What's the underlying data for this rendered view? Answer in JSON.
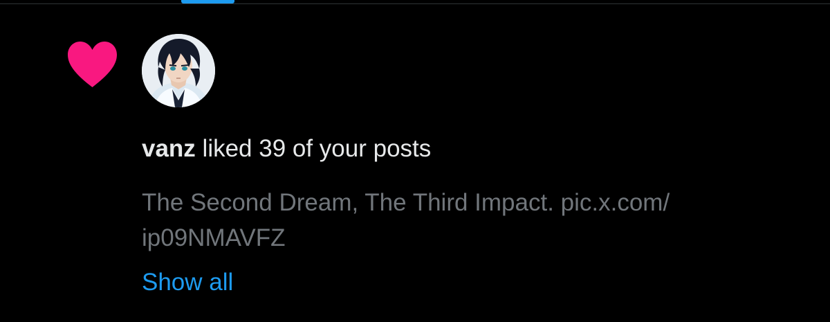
{
  "colors": {
    "background": "#000000",
    "accent": "#1d9bf0",
    "like": "#f91880",
    "primary_text": "#e7e9ea",
    "secondary_text": "#71767b"
  },
  "tab_indicator": {
    "active": true
  },
  "notification": {
    "type_icon": "heart-icon",
    "avatar": "anime-character-avatar",
    "username": "vanz",
    "action_text": " liked 39 of your posts",
    "post_text": "The Second Dream, The Third Impact. pic.x.com/ ip09NMAVFZ",
    "show_all_label": "Show all"
  }
}
